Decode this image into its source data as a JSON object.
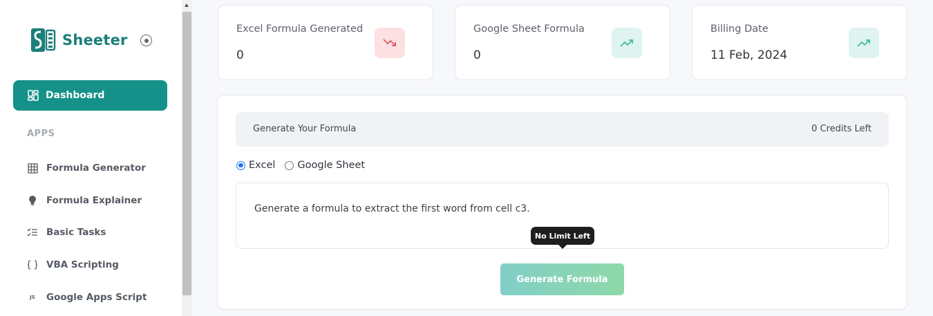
{
  "app": {
    "name": "Sheeter"
  },
  "sidebar": {
    "active_item": "Dashboard",
    "section_label": "APPS",
    "items": [
      {
        "label": "Formula Generator",
        "icon": "grid-icon"
      },
      {
        "label": "Formula Explainer",
        "icon": "lightbulb-icon"
      },
      {
        "label": "Basic Tasks",
        "icon": "checklist-icon"
      },
      {
        "label": "VBA Scripting",
        "icon": "braces-icon"
      },
      {
        "label": "Google Apps Script",
        "icon": "js-icon"
      }
    ]
  },
  "stats": [
    {
      "label": "Excel Formula Generated",
      "value": "0",
      "trend": "down",
      "icon": "trend-down-icon"
    },
    {
      "label": "Google Sheet Formula",
      "value": "0",
      "trend": "up",
      "icon": "trend-up-icon"
    },
    {
      "label": "Billing Date",
      "value": "11 Feb, 2024",
      "trend": "up",
      "icon": "trend-up-icon"
    }
  ],
  "generator": {
    "title": "Generate Your Formula",
    "credits": "0 Credits Left",
    "options": [
      {
        "label": "Excel",
        "checked": true
      },
      {
        "label": "Google Sheet",
        "checked": false
      }
    ],
    "prompt": "Generate a formula to extract the first word from cell c3.",
    "tooltip": "No Limit Left",
    "button_label": "Generate Formula"
  },
  "colors": {
    "brand": "#15918a",
    "trend_down": "#e05a65",
    "trend_up": "#3fbf9a"
  }
}
